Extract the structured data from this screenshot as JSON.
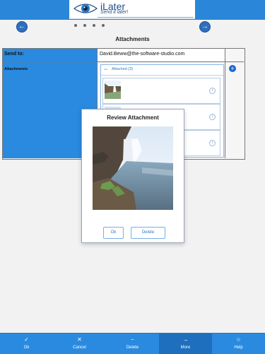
{
  "app": {
    "title": "iLater",
    "subtitle": "Send it later!"
  },
  "page": {
    "title": "Attachments"
  },
  "form": {
    "send_to_label": "Send to:",
    "send_to_value": "David.Beww@the-software-studio.com",
    "attachments_label": "Attachments",
    "attached_label": "Attached (3)"
  },
  "modal": {
    "title": "Review Attachment",
    "ok_label": "Ok",
    "delete_label": "Delete"
  },
  "tabs": [
    {
      "label": "Ok",
      "icon": "check-icon"
    },
    {
      "label": "Cancel",
      "icon": "close-icon"
    },
    {
      "label": "Delete",
      "icon": "minus-icon"
    },
    {
      "label": "More",
      "icon": "arrow-right-icon"
    },
    {
      "label": "Help",
      "icon": "star-icon"
    }
  ],
  "colors": {
    "accent": "#2a8ae0",
    "label_background": "#2a8ae0",
    "link": "#2d78c9"
  }
}
